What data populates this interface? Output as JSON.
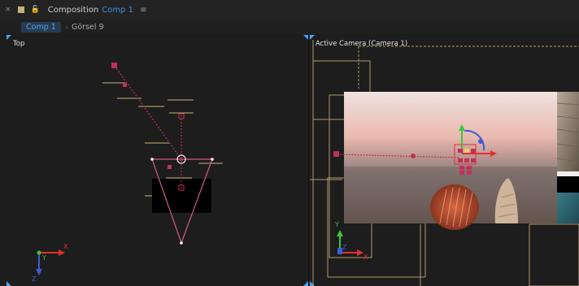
{
  "panel": {
    "close_glyph": "×",
    "lock_glyph": "🔓",
    "composition_label": "Composition",
    "composition_name": "Comp 1",
    "menu_glyph": "≡"
  },
  "breadcrumbs": {
    "active": "Comp 1",
    "separator": "‹",
    "next": "Görsel 9"
  },
  "left_view": {
    "label": "Top",
    "axes": {
      "x": "X",
      "y": "Y",
      "z": "Z"
    }
  },
  "right_view": {
    "label": "Active Camera (Camera 1)",
    "axes": {
      "x": "X",
      "y": "Y",
      "z": "Z"
    }
  },
  "colors": {
    "accent": "#3d8fd8",
    "guide": "#c8b27a",
    "camera": "#c0305a",
    "axis_x": "#e03030",
    "axis_y": "#3ec43e",
    "axis_z": "#3f5bd8"
  }
}
